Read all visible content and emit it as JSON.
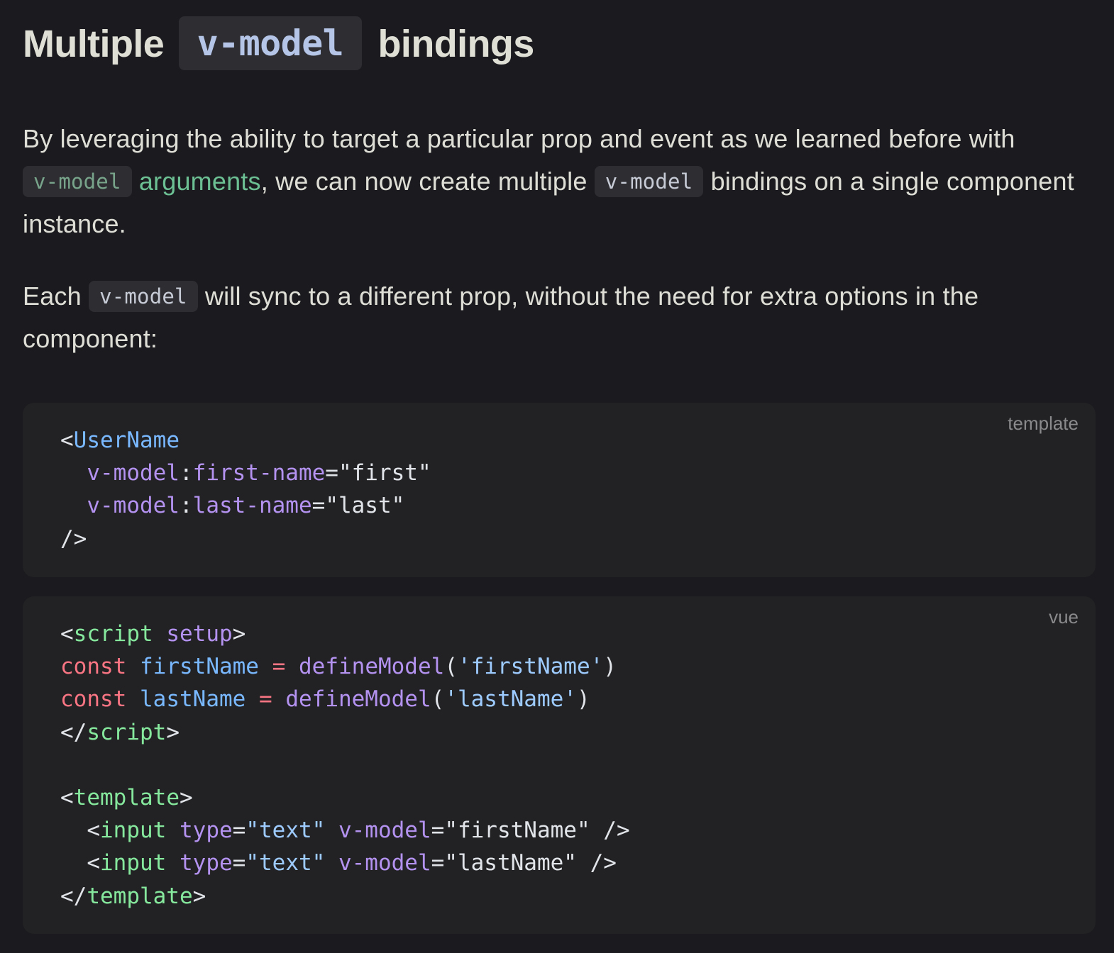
{
  "heading": {
    "prefix": "Multiple",
    "code": "v-model",
    "suffix": "bindings"
  },
  "paragraph1": {
    "text_before": "By leveraging the ability to target a particular prop and event as we learned before with ",
    "code1": "v-model",
    "link_text": "arguments",
    "text_mid": ", we can now create multiple ",
    "code2": "v-model",
    "text_after": " bindings on a single component instance."
  },
  "paragraph2": {
    "text_before": "Each ",
    "code": "v-model",
    "text_after": " will sync to a different prop, without the need for extra options in the component:"
  },
  "code_block_1": {
    "lang": "template",
    "tokens": {
      "l1_open": "<",
      "l1_comp": "UserName",
      "l2_attr": "v-model",
      "l2_colon": ":",
      "l2_arg": "first-name",
      "l2_eq": "=",
      "l2_val": "\"first\"",
      "l3_attr": "v-model",
      "l3_colon": ":",
      "l3_arg": "last-name",
      "l3_eq": "=",
      "l3_val": "\"last\"",
      "l4_close": "/>"
    }
  },
  "code_block_2": {
    "lang": "vue",
    "tokens": {
      "l1_lt": "<",
      "l1_tag": "script",
      "l1_attr": "setup",
      "l1_gt": ">",
      "l2_kw": "const",
      "l2_var": "firstName",
      "l2_op": "=",
      "l2_fn": "defineModel",
      "l2_open": "(",
      "l2_str": "'firstName'",
      "l2_close": ")",
      "l3_kw": "const",
      "l3_var": "lastName",
      "l3_op": "=",
      "l3_fn": "defineModel",
      "l3_open": "(",
      "l3_str": "'lastName'",
      "l3_close": ")",
      "l4_lt": "</",
      "l4_tag": "script",
      "l4_gt": ">",
      "l6_lt": "<",
      "l6_tag": "template",
      "l6_gt": ">",
      "l7_lt": "<",
      "l7_tag": "input",
      "l7_attr1": "type",
      "l7_eq1": "=",
      "l7_val1": "\"text\"",
      "l7_attr2": "v-model",
      "l7_eq2": "=",
      "l7_val2": "\"firstName\"",
      "l7_end": "/>",
      "l8_lt": "<",
      "l8_tag": "input",
      "l8_attr1": "type",
      "l8_eq1": "=",
      "l8_val1": "\"text\"",
      "l8_attr2": "v-model",
      "l8_eq2": "=",
      "l8_val2": "\"lastName\"",
      "l8_end": "/>",
      "l9_lt": "</",
      "l9_tag": "template",
      "l9_gt": ">"
    }
  }
}
